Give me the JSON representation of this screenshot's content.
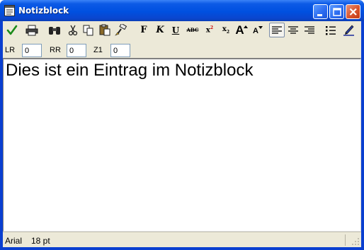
{
  "window": {
    "title": "Notizblock",
    "icon": "notepad-icon"
  },
  "titlebar_buttons": [
    "minimize-icon",
    "maximize-icon",
    "close-icon"
  ],
  "toolbar": {
    "tools": [
      {
        "name": "ok-check-icon"
      },
      {
        "name": "print-icon"
      },
      {
        "name": "find-binoculars-icon"
      },
      {
        "name": "cut-icon"
      },
      {
        "name": "copy-icon"
      },
      {
        "name": "paste-icon"
      },
      {
        "name": "format-painter-icon"
      },
      {
        "name": "bold-button",
        "glyph": "F"
      },
      {
        "name": "italic-button",
        "glyph": "K"
      },
      {
        "name": "underline-button",
        "glyph": "U"
      },
      {
        "name": "strikethrough-button",
        "glyph": "ABC"
      },
      {
        "name": "superscript-button",
        "glyph": "x",
        "sup": "2"
      },
      {
        "name": "subscript-button",
        "glyph": "x",
        "sub": "2"
      },
      {
        "name": "grow-font-button",
        "glyph": "A"
      },
      {
        "name": "shrink-font-button",
        "glyph": "A"
      },
      {
        "name": "align-left-icon",
        "pressed": true
      },
      {
        "name": "align-center-icon"
      },
      {
        "name": "align-right-icon"
      },
      {
        "name": "bullet-list-icon"
      },
      {
        "name": "pen-color-icon"
      }
    ]
  },
  "margins": {
    "left_label": "LR",
    "left_value": "0",
    "right_label": "RR",
    "right_value": "0",
    "indent_label": "Z1",
    "indent_value": "0"
  },
  "editor": {
    "text": "Dies ist ein Eintrag im Notizblock"
  },
  "status": {
    "font": "Arial",
    "size": "18 pt"
  },
  "colors": {
    "titlebar": "#0050e0",
    "face": "#ece9d8",
    "check": "#1a8a1a",
    "close": "#d8542e"
  }
}
